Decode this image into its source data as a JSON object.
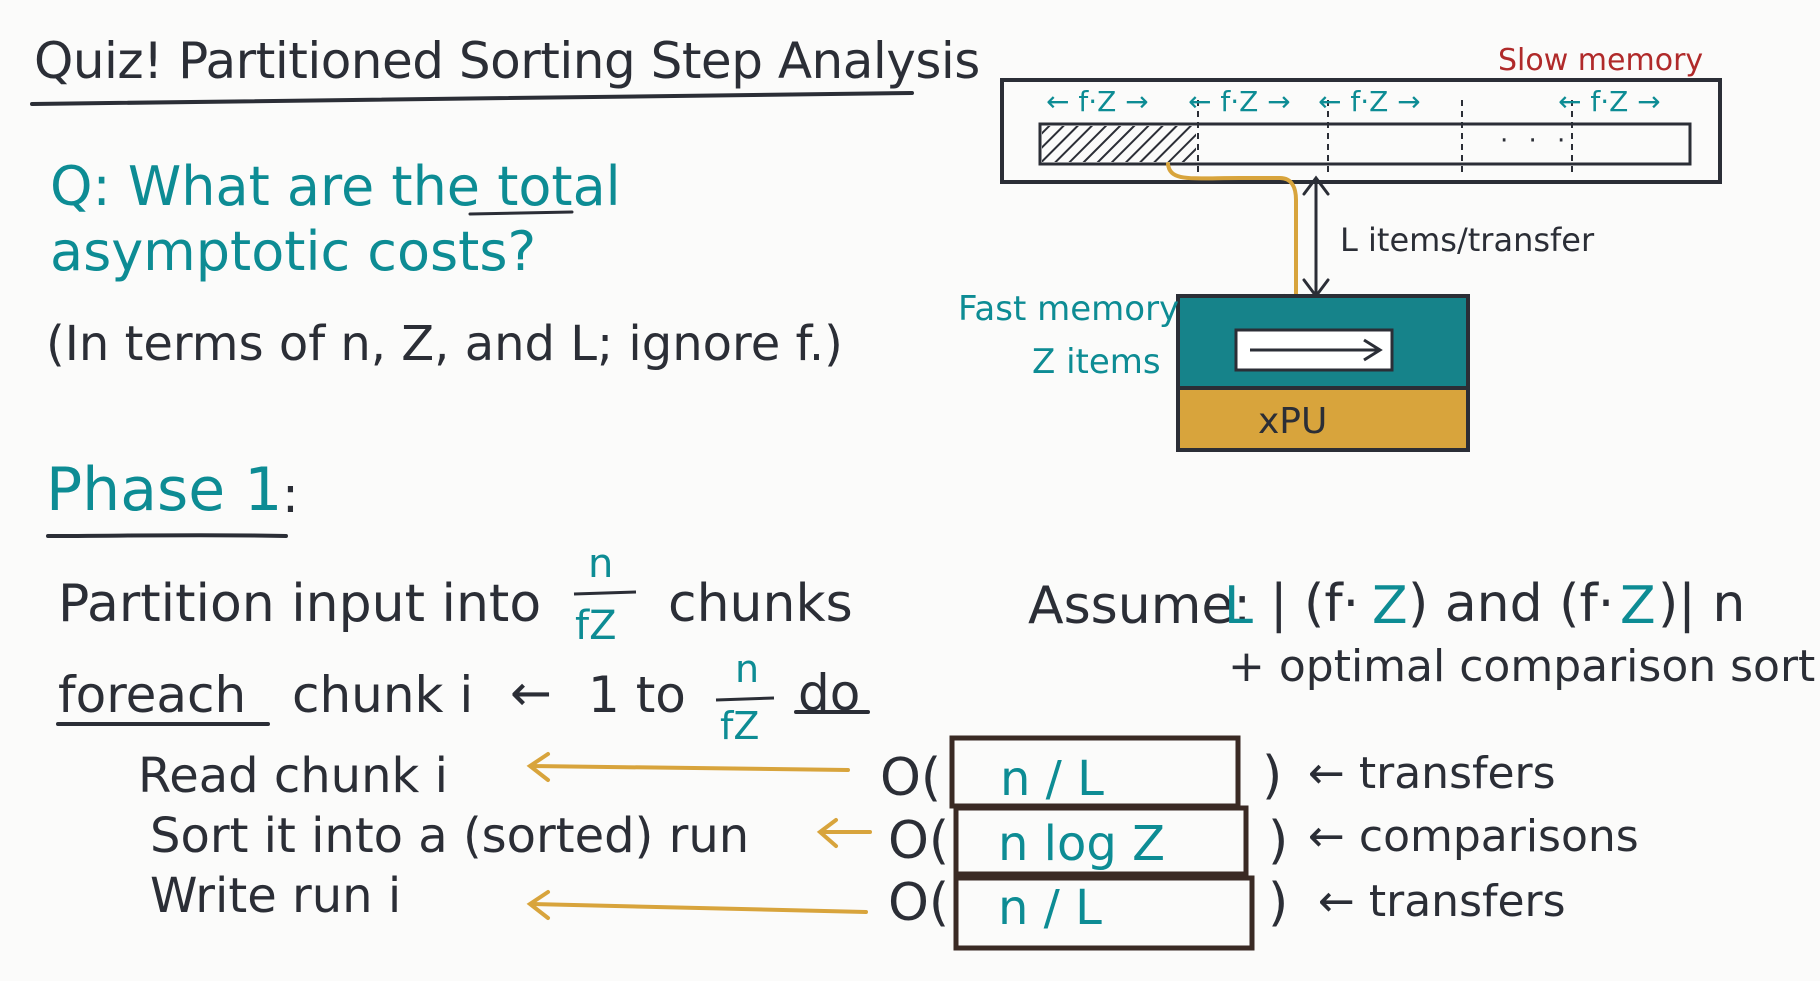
{
  "title": "Quiz! Partitioned Sorting Step Analysis",
  "question": {
    "line1": "Q: What are the total",
    "line2": "asymptotic costs?",
    "line3": "(In terms of n, Z, and L; ignore f.)"
  },
  "phase": {
    "label": "Phase 1",
    "colon": ":",
    "partition_before": "Partition input into",
    "partition_after": "chunks",
    "fraction_num": "n",
    "fraction_den": "fZ",
    "foreach_kw": "foreach",
    "chunk_var": "chunk i",
    "arrow": "←",
    "range_start": "1 to",
    "do_kw": "do",
    "steps": [
      {
        "text": "Read chunk i",
        "cost": "n / L",
        "label": "transfers"
      },
      {
        "text": "Sort it into a (sorted) run",
        "cost": "n log Z",
        "label": "comparisons"
      },
      {
        "text": "Write run i",
        "cost": "n / L",
        "label": "transfers"
      }
    ],
    "big_o_open": "O(",
    "big_o_close": ")",
    "label_arrow": "←"
  },
  "assume": {
    "prefix": "Assume:",
    "L": "L",
    "mid1": "| (f·",
    "Z": "Z",
    "mid2": ") and (f·",
    "suffix": ")| n",
    "line2": "+ optimal comparison sort"
  },
  "diagram": {
    "slow_memory": "Slow memory",
    "segment_label": "← f·Z →",
    "dots": "· · ·",
    "transfer_label": "L items/transfer",
    "fast_memory": "Fast memory",
    "fast_capacity": "Z items",
    "processor": "xPU"
  },
  "colors": {
    "ink": "#2b2e36",
    "teal": "#0d8c94",
    "gold": "#d8a43c",
    "red": "#b02a2a",
    "box_border": "#3a2a24"
  }
}
